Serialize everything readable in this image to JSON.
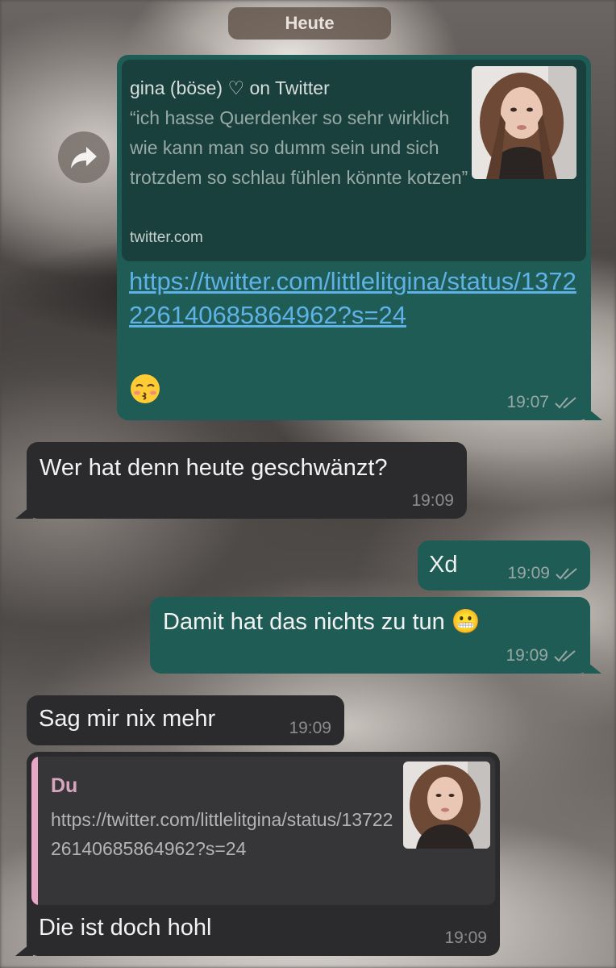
{
  "date_separator": "Heute",
  "messages": [
    {
      "direction": "out",
      "preview": {
        "title": "gina (böse) ♡ on Twitter",
        "description": "“ich hasse Querdenker so sehr wirklich wie kann man so dumm sein und sich trotzdem so schlau fühlen könnte kotzen”",
        "domain": "twitter.com"
      },
      "link": "https://twitter.com/littlelitgina/status/1372226140685864962?s=24",
      "emoji": "kissing-face-emoji",
      "time": "19:07",
      "status": "read"
    },
    {
      "direction": "in",
      "text": "Wer hat denn heute geschwänzt?",
      "time": "19:09"
    },
    {
      "direction": "out",
      "text": "Xd",
      "time": "19:09",
      "status": "read"
    },
    {
      "direction": "out",
      "text": "Damit hat das nichts zu tun 😬",
      "time": "19:09",
      "status": "read"
    },
    {
      "direction": "in",
      "text": "Sag mir nix mehr",
      "time": "19:09"
    },
    {
      "direction": "in",
      "quote": {
        "author": "Du",
        "text": "https://twitter.com/littlelitgina/status/1372226140685864962?s=24"
      },
      "text": "Die ist doch hohl",
      "time": "19:09"
    }
  ],
  "colors": {
    "outgoing_bubble": "#1f5c55",
    "incoming_bubble": "#2b2b2d",
    "link": "#5fb2e6",
    "quote_accent": "#e9a7c8"
  },
  "icons": [
    "forward-icon",
    "double-check-icon",
    "profile-photo-thumbnail"
  ]
}
